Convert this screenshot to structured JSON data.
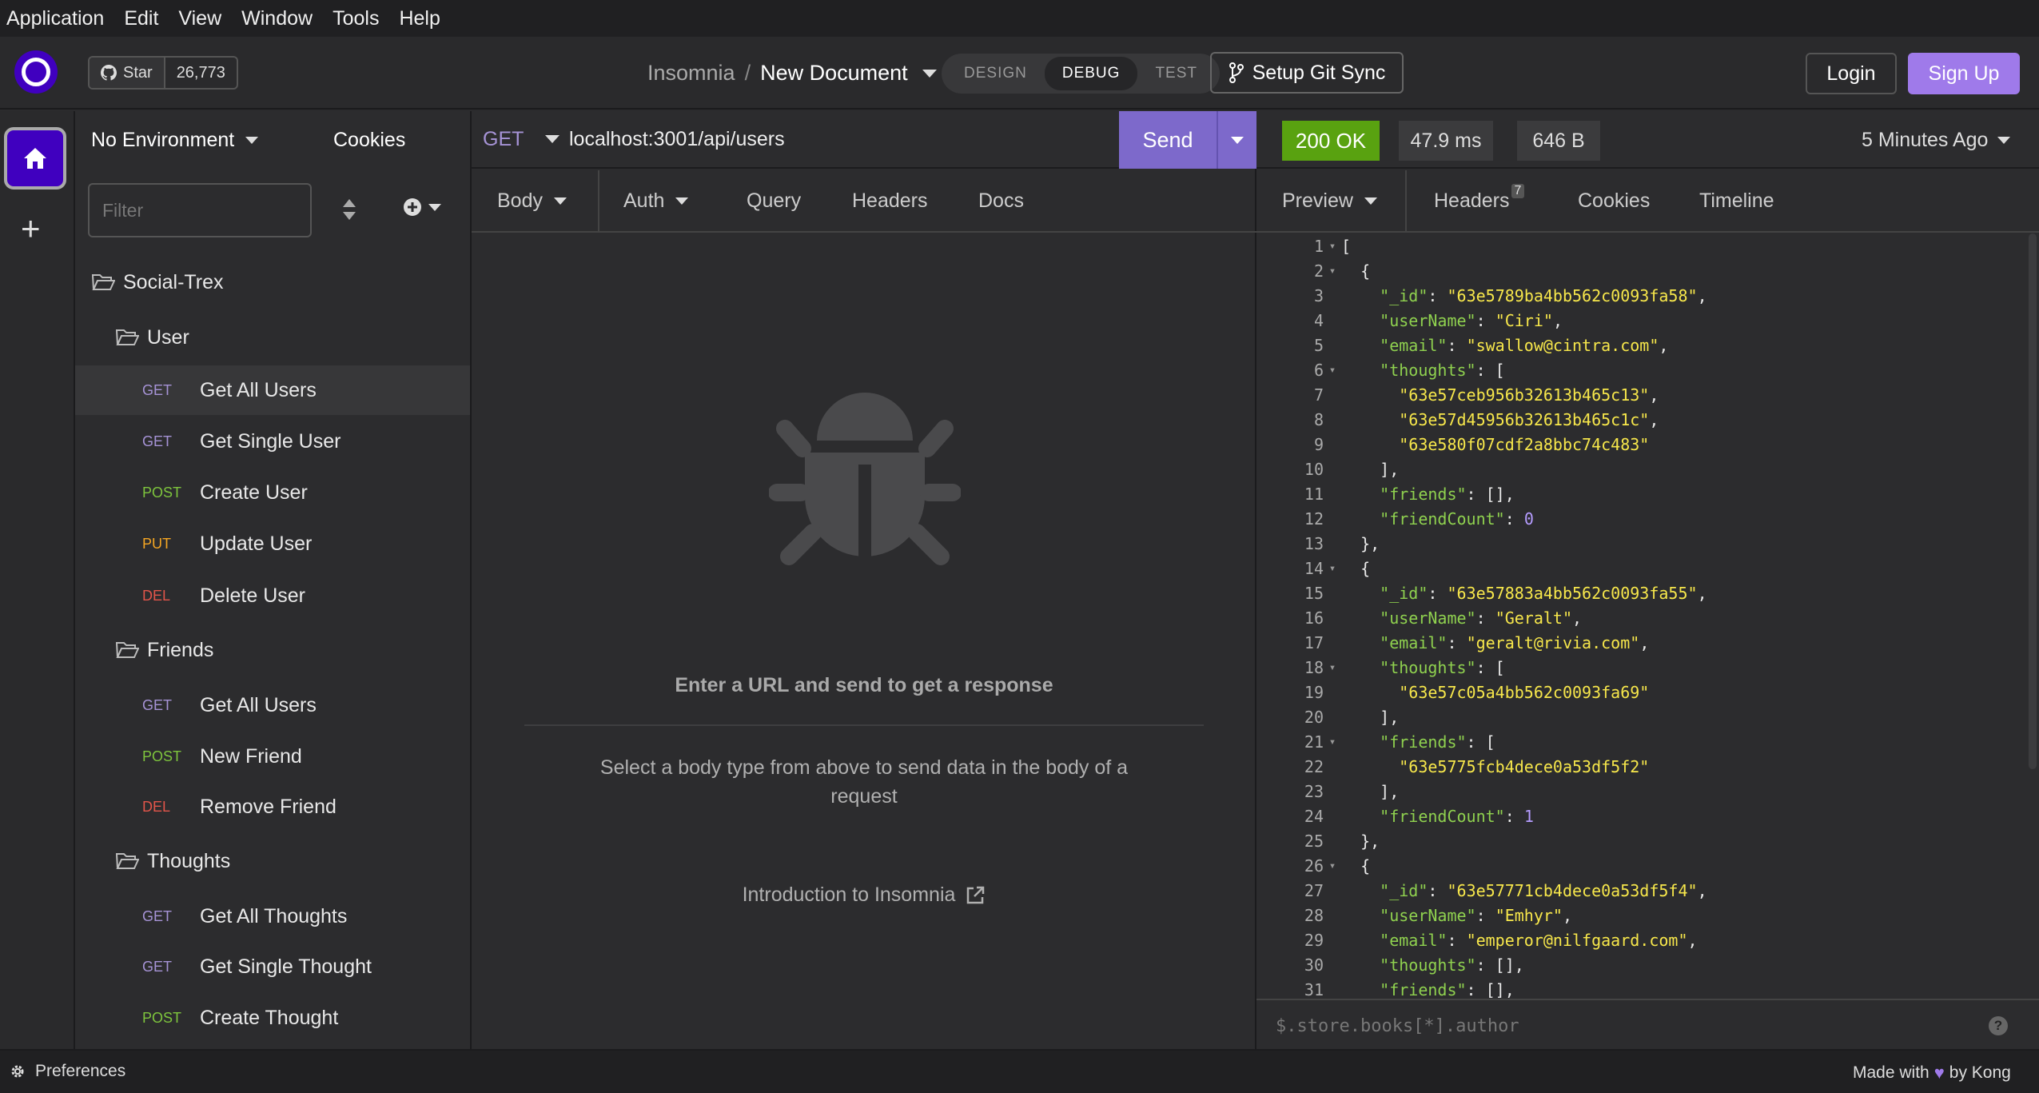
{
  "menubar": [
    "Application",
    "Edit",
    "View",
    "Window",
    "Tools",
    "Help"
  ],
  "github": {
    "star_label": "Star",
    "star_count": "26,773"
  },
  "breadcrumb": {
    "workspace": "Insomnia",
    "separator": "/",
    "document": "New Document"
  },
  "modes": [
    "DESIGN",
    "DEBUG",
    "TEST"
  ],
  "active_mode": "DEBUG",
  "git_sync_label": "Setup Git Sync",
  "login_label": "Login",
  "signup_label": "Sign Up",
  "sidebar": {
    "environment": "No Environment",
    "cookies": "Cookies",
    "filter_placeholder": "Filter",
    "tree": [
      {
        "type": "folder",
        "label": "Social-Trex",
        "level": 0
      },
      {
        "type": "folder",
        "label": "User",
        "level": 1
      },
      {
        "type": "request",
        "method": "GET",
        "label": "Get All Users",
        "selected": true
      },
      {
        "type": "request",
        "method": "GET",
        "label": "Get Single User"
      },
      {
        "type": "request",
        "method": "POST",
        "label": "Create User"
      },
      {
        "type": "request",
        "method": "PUT",
        "label": "Update User"
      },
      {
        "type": "request",
        "method": "DEL",
        "label": "Delete User"
      },
      {
        "type": "folder",
        "label": "Friends",
        "level": 1
      },
      {
        "type": "request",
        "method": "GET",
        "label": "Get All Users"
      },
      {
        "type": "request",
        "method": "POST",
        "label": "New Friend"
      },
      {
        "type": "request",
        "method": "DEL",
        "label": "Remove Friend"
      },
      {
        "type": "folder",
        "label": "Thoughts",
        "level": 1
      },
      {
        "type": "request",
        "method": "GET",
        "label": "Get All Thoughts"
      },
      {
        "type": "request",
        "method": "GET",
        "label": "Get Single Thought"
      },
      {
        "type": "request",
        "method": "POST",
        "label": "Create Thought"
      }
    ]
  },
  "request": {
    "method": "GET",
    "url": "localhost:3001/api/users",
    "send_label": "Send",
    "tabs": [
      "Body",
      "Auth",
      "Query",
      "Headers",
      "Docs"
    ],
    "empty_heading": "Enter a URL and send to get a response",
    "empty_sub": "Select a body type from above to send data in the body of a request",
    "intro_link": "Introduction to Insomnia"
  },
  "response": {
    "status": "200 OK",
    "time": "47.9 ms",
    "size": "646 B",
    "ago": "5 Minutes Ago",
    "tabs": [
      "Preview",
      "Headers",
      "Cookies",
      "Timeline"
    ],
    "headers_count": "7",
    "filter_placeholder": "$.store.books[*].author",
    "help": "?",
    "code_lines": [
      [
        {
          "t": "p",
          "v": "["
        }
      ],
      [
        {
          "t": "p",
          "v": "  {"
        }
      ],
      [
        {
          "t": "p",
          "v": "    "
        },
        {
          "t": "k",
          "v": "\"_id\""
        },
        {
          "t": "p",
          "v": ": "
        },
        {
          "t": "s",
          "v": "\"63e5789ba4bb562c0093fa58\""
        },
        {
          "t": "p",
          "v": ","
        }
      ],
      [
        {
          "t": "p",
          "v": "    "
        },
        {
          "t": "k",
          "v": "\"userName\""
        },
        {
          "t": "p",
          "v": ": "
        },
        {
          "t": "s",
          "v": "\"Ciri\""
        },
        {
          "t": "p",
          "v": ","
        }
      ],
      [
        {
          "t": "p",
          "v": "    "
        },
        {
          "t": "k",
          "v": "\"email\""
        },
        {
          "t": "p",
          "v": ": "
        },
        {
          "t": "s",
          "v": "\"swallow@cintra.com\""
        },
        {
          "t": "p",
          "v": ","
        }
      ],
      [
        {
          "t": "p",
          "v": "    "
        },
        {
          "t": "k",
          "v": "\"thoughts\""
        },
        {
          "t": "p",
          "v": ": ["
        }
      ],
      [
        {
          "t": "p",
          "v": "      "
        },
        {
          "t": "s",
          "v": "\"63e57ceb956b32613b465c13\""
        },
        {
          "t": "p",
          "v": ","
        }
      ],
      [
        {
          "t": "p",
          "v": "      "
        },
        {
          "t": "s",
          "v": "\"63e57d45956b32613b465c1c\""
        },
        {
          "t": "p",
          "v": ","
        }
      ],
      [
        {
          "t": "p",
          "v": "      "
        },
        {
          "t": "s",
          "v": "\"63e580f07cdf2a8bbc74c483\""
        }
      ],
      [
        {
          "t": "p",
          "v": "    ],"
        }
      ],
      [
        {
          "t": "p",
          "v": "    "
        },
        {
          "t": "k",
          "v": "\"friends\""
        },
        {
          "t": "p",
          "v": ": [],"
        }
      ],
      [
        {
          "t": "p",
          "v": "    "
        },
        {
          "t": "k",
          "v": "\"friendCount\""
        },
        {
          "t": "p",
          "v": ": "
        },
        {
          "t": "n",
          "v": "0"
        }
      ],
      [
        {
          "t": "p",
          "v": "  },"
        }
      ],
      [
        {
          "t": "p",
          "v": "  {"
        }
      ],
      [
        {
          "t": "p",
          "v": "    "
        },
        {
          "t": "k",
          "v": "\"_id\""
        },
        {
          "t": "p",
          "v": ": "
        },
        {
          "t": "s",
          "v": "\"63e57883a4bb562c0093fa55\""
        },
        {
          "t": "p",
          "v": ","
        }
      ],
      [
        {
          "t": "p",
          "v": "    "
        },
        {
          "t": "k",
          "v": "\"userName\""
        },
        {
          "t": "p",
          "v": ": "
        },
        {
          "t": "s",
          "v": "\"Geralt\""
        },
        {
          "t": "p",
          "v": ","
        }
      ],
      [
        {
          "t": "p",
          "v": "    "
        },
        {
          "t": "k",
          "v": "\"email\""
        },
        {
          "t": "p",
          "v": ": "
        },
        {
          "t": "s",
          "v": "\"geralt@rivia.com\""
        },
        {
          "t": "p",
          "v": ","
        }
      ],
      [
        {
          "t": "p",
          "v": "    "
        },
        {
          "t": "k",
          "v": "\"thoughts\""
        },
        {
          "t": "p",
          "v": ": ["
        }
      ],
      [
        {
          "t": "p",
          "v": "      "
        },
        {
          "t": "s",
          "v": "\"63e57c05a4bb562c0093fa69\""
        }
      ],
      [
        {
          "t": "p",
          "v": "    ],"
        }
      ],
      [
        {
          "t": "p",
          "v": "    "
        },
        {
          "t": "k",
          "v": "\"friends\""
        },
        {
          "t": "p",
          "v": ": ["
        }
      ],
      [
        {
          "t": "p",
          "v": "      "
        },
        {
          "t": "s",
          "v": "\"63e5775fcb4dece0a53df5f2\""
        }
      ],
      [
        {
          "t": "p",
          "v": "    ],"
        }
      ],
      [
        {
          "t": "p",
          "v": "    "
        },
        {
          "t": "k",
          "v": "\"friendCount\""
        },
        {
          "t": "p",
          "v": ": "
        },
        {
          "t": "n",
          "v": "1"
        }
      ],
      [
        {
          "t": "p",
          "v": "  },"
        }
      ],
      [
        {
          "t": "p",
          "v": "  {"
        }
      ],
      [
        {
          "t": "p",
          "v": "    "
        },
        {
          "t": "k",
          "v": "\"_id\""
        },
        {
          "t": "p",
          "v": ": "
        },
        {
          "t": "s",
          "v": "\"63e57771cb4dece0a53df5f4\""
        },
        {
          "t": "p",
          "v": ","
        }
      ],
      [
        {
          "t": "p",
          "v": "    "
        },
        {
          "t": "k",
          "v": "\"userName\""
        },
        {
          "t": "p",
          "v": ": "
        },
        {
          "t": "s",
          "v": "\"Emhyr\""
        },
        {
          "t": "p",
          "v": ","
        }
      ],
      [
        {
          "t": "p",
          "v": "    "
        },
        {
          "t": "k",
          "v": "\"email\""
        },
        {
          "t": "p",
          "v": ": "
        },
        {
          "t": "s",
          "v": "\"emperor@nilfgaard.com\""
        },
        {
          "t": "p",
          "v": ","
        }
      ],
      [
        {
          "t": "p",
          "v": "    "
        },
        {
          "t": "k",
          "v": "\"thoughts\""
        },
        {
          "t": "p",
          "v": ": [],"
        }
      ],
      [
        {
          "t": "p",
          "v": "    "
        },
        {
          "t": "k",
          "v": "\"friends\""
        },
        {
          "t": "p",
          "v": ": [],"
        }
      ]
    ],
    "fold_lines": [
      1,
      2,
      6,
      14,
      18,
      21,
      26
    ]
  },
  "footer": {
    "preferences": "Preferences",
    "made_with": "Made with",
    "by": "by Kong"
  }
}
